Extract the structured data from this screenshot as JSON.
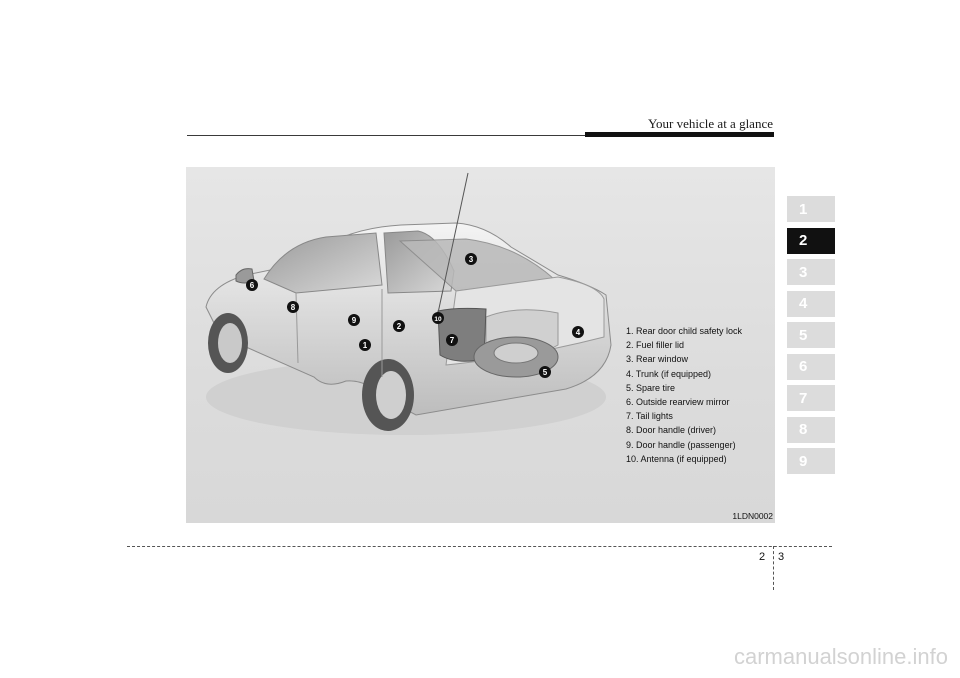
{
  "header": {
    "title": "Your vehicle at a glance"
  },
  "figure": {
    "code": "1LDN0002",
    "callouts": [
      "1",
      "2",
      "3",
      "4",
      "5",
      "6",
      "7",
      "8",
      "9",
      "10"
    ],
    "legend": [
      "1. Rear door child safety lock",
      "2. Fuel filler lid",
      "3. Rear window",
      "4. Trunk (if equipped)",
      "5. Spare tire",
      "6. Outside rearview mirror",
      "7. Tail lights",
      "8. Door handle (driver)",
      "9. Door handle  (passenger)",
      "10. Antenna (if equipped)"
    ]
  },
  "chapter_tabs": [
    "1",
    "2",
    "3",
    "4",
    "5",
    "6",
    "7",
    "8",
    "9"
  ],
  "active_chapter": "2",
  "page": {
    "chapter": "2",
    "number": "3"
  },
  "watermark": "carmanualsonline.info"
}
